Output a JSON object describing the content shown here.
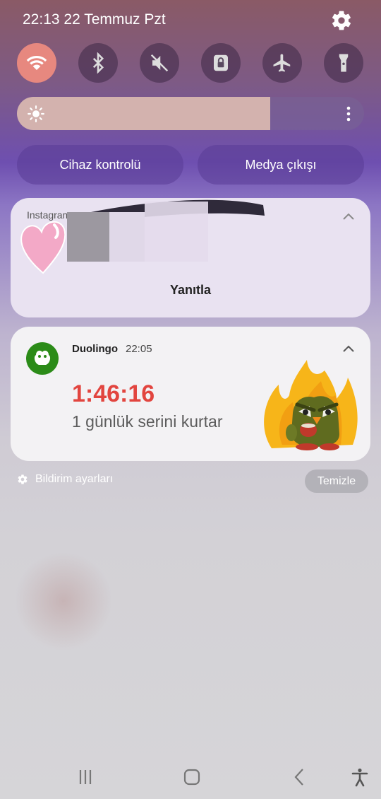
{
  "status_bar": {
    "time_date": "22:13  22 Temmuz Pzt",
    "settings_icon": "gear-icon"
  },
  "quick_settings": [
    {
      "name": "wifi",
      "icon": "wifi-icon",
      "active": true
    },
    {
      "name": "bluetooth",
      "icon": "bluetooth-icon",
      "active": false
    },
    {
      "name": "sound",
      "icon": "mute-icon",
      "active": false
    },
    {
      "name": "rotation-lock",
      "icon": "lock-icon",
      "active": false
    },
    {
      "name": "airplane",
      "icon": "airplane-icon",
      "active": false
    },
    {
      "name": "flashlight",
      "icon": "flashlight-icon",
      "active": false
    }
  ],
  "brightness": {
    "level": 0.73,
    "icon": "sun-icon",
    "menu_icon": "kebab-icon"
  },
  "device_controls": {
    "label": "Cihaz kontrolü"
  },
  "media_output": {
    "label": "Medya çıkışı"
  },
  "notifications": {
    "instagram": {
      "app_name": "Instagram",
      "action": "Yanıtla"
    },
    "duolingo": {
      "app_name": "Duolingo",
      "time": "22:05",
      "timer": "1:46:16",
      "message": "1 günlük serini kurtar"
    }
  },
  "footer": {
    "settings_label": "Bildirim ayarları",
    "clear_label": "Temizle"
  },
  "colors": {
    "accent_on": "#e7887f",
    "timer": "#e2453f",
    "duo_green": "#2b8b18"
  },
  "navigation": [
    "recents-icon",
    "home-icon",
    "back-icon",
    "accessibility-icon"
  ]
}
